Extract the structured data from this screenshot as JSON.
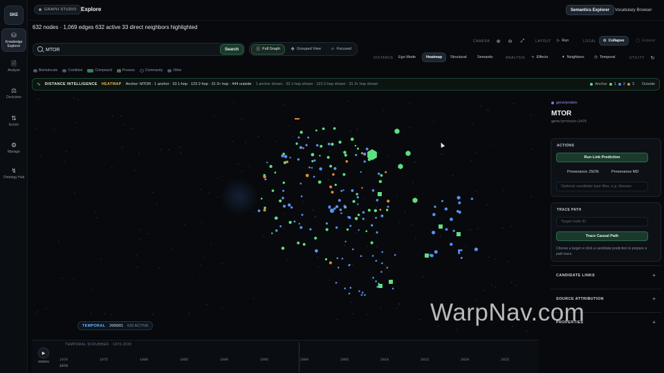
{
  "sidebar": {
    "logo": "SKE",
    "items": [
      {
        "label": "Knowledge Explorer",
        "icon": "database-icon"
      },
      {
        "label": "Analyze",
        "icon": "document-icon"
      },
      {
        "label": "Decisions",
        "icon": "scale-icon"
      },
      {
        "label": "Enrich",
        "icon": "branch-icon"
      },
      {
        "label": "Manage",
        "icon": "sliders-icon"
      },
      {
        "label": "Ontology Hub",
        "icon": "hub-icon"
      }
    ]
  },
  "topbar": {
    "studio": "GRAPH STUDIO",
    "title": "Explore",
    "semantics_button": "Semantics Explorer",
    "vocabulary_button": "Vocabulary Browser"
  },
  "summary": "632 nodes · 1,069 edges  632 active  33 direct neighbors highlighted",
  "search": {
    "value": "MTOR",
    "button": "Search"
  },
  "view_modes": [
    "Full Graph",
    "Grouped View",
    "Focused"
  ],
  "legend": [
    {
      "label": "Biomolecule",
      "color": "#4d5a68"
    },
    {
      "label": "Condition",
      "color": "#4d5a68"
    },
    {
      "label": "Compound",
      "color": "#3c7d5c"
    },
    {
      "label": "Process",
      "color": "#4d6a5a"
    },
    {
      "label": "Community",
      "color": "#4d5a68"
    },
    {
      "label": "Other",
      "color": "#4d5a68"
    }
  ],
  "toolbar": {
    "camera_label": "CAMERA",
    "layout_label": "LAYOUT",
    "run": "Run",
    "local_label": "LOCAL",
    "collapse": "Collapse",
    "expand": "Expand",
    "distance_label": "DISTANCE",
    "ego_mode": "Ego Mode",
    "heatmap": "Heatmap",
    "structural": "Structural",
    "semantic": "Semantic",
    "analysis_label": "ANALYSIS",
    "effects": "Effects",
    "neighbors": "Neighbors",
    "temporal": "Temporal",
    "utility_label": "UTILITY"
  },
  "distance_bar": {
    "title": "DISTANCE INTELLIGENCE",
    "badge": "HEATMAP",
    "anchor_text": "Anchor: MTOR · 1 anchor · 33 1-hop · 123 2-hop · 31 3+ hop · 444 outside",
    "shown_text": "1 anchor shown · 33 1-hop shown · 123 2-hop shown · 31 3+ hop shown",
    "legend_anchor": "Anchor",
    "legend_1": "1",
    "legend_2": "2",
    "legend_3": "3",
    "legend_outside": "Outside"
  },
  "temporal": {
    "label": "TEMPORAL",
    "date": "2000/01",
    "active": "632 ACTIVE"
  },
  "scrubber": {
    "label": "TEMPORAL SCRUBBER · 1970-2030",
    "current_date": "2000/01",
    "current_year": "1970",
    "ticks": [
      "1970",
      "1975",
      "1980",
      "1985",
      "1990",
      "1995",
      "2000",
      "2005",
      "2010",
      "2015",
      "2020",
      "2025"
    ]
  },
  "panel": {
    "tag": "gene/protein",
    "title": "MTOR",
    "subtitle": "gene/protein:2475",
    "actions_header": "ACTIONS",
    "run_link_prediction": "Run Link Prediction",
    "provenance_json": "Provenance JSON",
    "provenance_md": "Provenance MD",
    "filter_placeholder": "Optional candidate type filter, e.g. disease",
    "trace_header": "TRACE PATH",
    "target_placeholder": "Target node ID",
    "trace_button": "Trace Causal Path",
    "trace_note": "Choose a target or click a candidate prediction to prepare a path trace.",
    "sections": [
      "CANDIDATE LINKS",
      "SOURCE ATTRIBUTION",
      "PROPERTIES"
    ]
  },
  "colors": {
    "accent_green": "#5ee07f",
    "node_blue": "#5a8ff0",
    "node_orange": "#e08a3c",
    "heatmap_badge": "#f0b24a"
  },
  "watermark": "WarpNav.com"
}
